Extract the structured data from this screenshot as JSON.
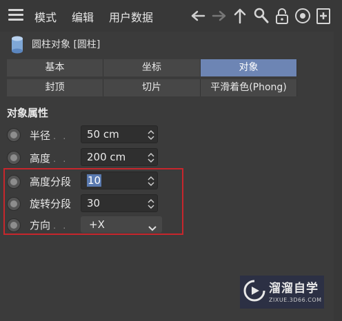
{
  "menu": {
    "items": [
      "模式",
      "编辑",
      "用户数据"
    ]
  },
  "toolbar": {
    "icons": [
      "arrow-left-icon",
      "arrow-right-icon",
      "arrow-up-icon",
      "search-icon",
      "lock-icon",
      "target-icon",
      "new-panel-icon"
    ]
  },
  "object": {
    "title": "圆柱对象 [圆柱]",
    "icon": "cylinder-icon"
  },
  "tabs_row1": [
    {
      "label": "基本",
      "active": false
    },
    {
      "label": "坐标",
      "active": false
    },
    {
      "label": "对象",
      "active": true
    }
  ],
  "tabs_row2": [
    {
      "label": "封顶"
    },
    {
      "label": "切片"
    },
    {
      "label": "平滑着色(Phong)"
    }
  ],
  "section": {
    "title": "对象属性"
  },
  "properties": [
    {
      "label": "半径",
      "dots": ". .",
      "value": "50 cm"
    },
    {
      "label": "高度",
      "dots": ". .",
      "value": "200 cm"
    },
    {
      "label": "高度分段",
      "dots": "",
      "value": "10"
    },
    {
      "label": "旋转分段",
      "dots": "",
      "value": "30"
    },
    {
      "label": "方向",
      "dots": ". .",
      "value": "+X"
    }
  ],
  "watermark": {
    "title": "溜溜自学",
    "url": "ZIXUE.3D66.COM"
  },
  "colors": {
    "accent": "#6d85b4",
    "highlight": "#c8262c",
    "background": "#3b3b3b"
  }
}
